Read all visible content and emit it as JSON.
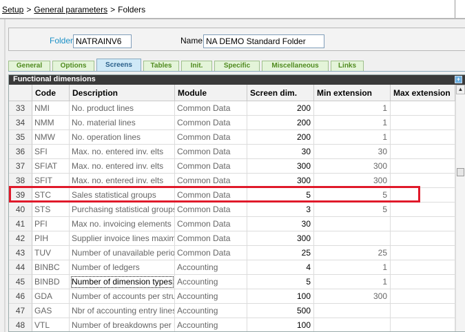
{
  "breadcrumb": {
    "root": "Setup",
    "parent": "General parameters",
    "current": "Folders",
    "separator": ">"
  },
  "header": {
    "folder_label": "Folder",
    "folder_value": "NATRAINV6",
    "name_label": "Name",
    "name_value": "NA DEMO Standard Folder"
  },
  "tabs": [
    {
      "label": "General"
    },
    {
      "label": "Options"
    },
    {
      "label": "Screens",
      "active": true
    },
    {
      "label": "Tables"
    },
    {
      "label": "Init."
    },
    {
      "label": "Specific"
    },
    {
      "label": "Miscellaneous"
    },
    {
      "label": "Links"
    }
  ],
  "section": {
    "title": "Functional dimensions",
    "columns": [
      "Code",
      "Description",
      "Module",
      "Screen dim.",
      "Min extension",
      "Max extension"
    ]
  },
  "rows": [
    {
      "num": "33",
      "code": "NMI",
      "desc": "No. product lines",
      "module": "Common Data",
      "screen": "200",
      "min": "1",
      "max": ""
    },
    {
      "num": "34",
      "code": "NMM",
      "desc": "No. material lines",
      "module": "Common Data",
      "screen": "200",
      "min": "1",
      "max": ""
    },
    {
      "num": "35",
      "code": "NMW",
      "desc": "No. operation lines",
      "module": "Common Data",
      "screen": "200",
      "min": "1",
      "max": ""
    },
    {
      "num": "36",
      "code": "SFI",
      "desc": "Max. no. entered inv. elts",
      "module": "Common Data",
      "screen": "30",
      "min": "30",
      "max": ""
    },
    {
      "num": "37",
      "code": "SFIAT",
      "desc": "Max. no. entered inv. elts",
      "module": "Common Data",
      "screen": "300",
      "min": "300",
      "max": ""
    },
    {
      "num": "38",
      "code": "SFIT",
      "desc": "Max. no. entered inv. elts",
      "module": "Common Data",
      "screen": "300",
      "min": "300",
      "max": ""
    },
    {
      "num": "39",
      "code": "STC",
      "desc": "Sales statistical groups",
      "module": "Common Data",
      "screen": "5",
      "min": "5",
      "max": ""
    },
    {
      "num": "40",
      "code": "STS",
      "desc": "Purchasing statistical groups",
      "module": "Common Data",
      "screen": "3",
      "min": "5",
      "max": ""
    },
    {
      "num": "41",
      "code": "PFI",
      "desc": "Max no. invoicing elements",
      "module": "Common Data",
      "screen": "30",
      "min": "",
      "max": ""
    },
    {
      "num": "42",
      "code": "PIH",
      "desc": "Supplier invoice lines maximum",
      "module": "Common Data",
      "screen": "300",
      "min": "",
      "max": ""
    },
    {
      "num": "43",
      "code": "TUV",
      "desc": "Number of unavailable periods",
      "module": "Common Data",
      "screen": "25",
      "min": "25",
      "max": ""
    },
    {
      "num": "44",
      "code": "BINBC",
      "desc": "Number of ledgers",
      "module": "Accounting",
      "screen": "4",
      "min": "1",
      "max": ""
    },
    {
      "num": "45",
      "code": "BINBD",
      "desc": "Number of dimension types",
      "module": "Accounting",
      "screen": "5",
      "min": "1",
      "max": ""
    },
    {
      "num": "46",
      "code": "GDA",
      "desc": "Number of accounts per structure",
      "module": "Accounting",
      "screen": "100",
      "min": "300",
      "max": ""
    },
    {
      "num": "47",
      "code": "GAS",
      "desc": "Nbr of accounting entry lines",
      "module": "Accounting",
      "screen": "500",
      "min": "",
      "max": ""
    },
    {
      "num": "48",
      "code": "VTL",
      "desc": "Number of breakdowns per line",
      "module": "Accounting",
      "screen": "100",
      "min": "",
      "max": ""
    }
  ],
  "colors": {
    "highlight": "#e0192a",
    "tab_text": "#4f8a1e",
    "active_tab": "#cfe9f7",
    "section_title_bg": "#3a3a3a"
  },
  "icons": {
    "expand": "expand-icon",
    "scroll_up": "scroll-up-icon",
    "scroll_down": "scroll-down-icon"
  }
}
